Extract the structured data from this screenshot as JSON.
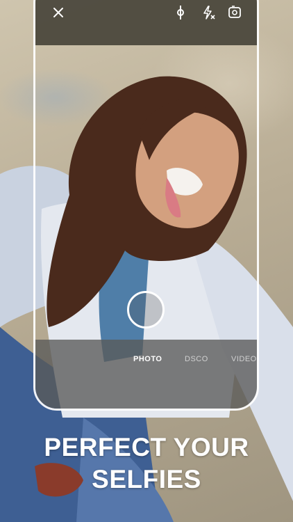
{
  "camera": {
    "top_icons": [
      "close-icon",
      "exposure-icon",
      "flash-off-icon",
      "flip-camera-icon"
    ],
    "modes": [
      {
        "label": "PHOTO",
        "selected": true
      },
      {
        "label": "DSCO",
        "selected": false
      },
      {
        "label": "VIDEO",
        "selected": false
      }
    ]
  },
  "headline": {
    "line1": "PERFECT YOUR",
    "line2": "SELFIES"
  },
  "colors": {
    "frame": "#ffffff",
    "top_bar": "#48443a",
    "mode_bar": "#5a5a58"
  }
}
